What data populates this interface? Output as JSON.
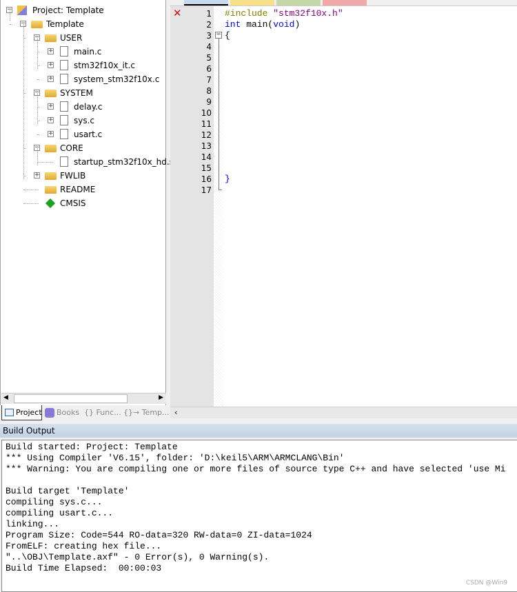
{
  "project_tree": [
    {
      "label": "Project: Template",
      "level": 0,
      "type": "project",
      "toggle": "-"
    },
    {
      "label": "Template",
      "level": 1,
      "type": "target",
      "toggle": "-"
    },
    {
      "label": "USER",
      "level": 2,
      "type": "folder",
      "toggle": "-"
    },
    {
      "label": "main.c",
      "level": 3,
      "type": "file",
      "toggle": "+"
    },
    {
      "label": "stm32f10x_it.c",
      "level": 3,
      "type": "file",
      "toggle": "+"
    },
    {
      "label": "system_stm32f10x.c",
      "level": 3,
      "type": "file",
      "toggle": "+"
    },
    {
      "label": "SYSTEM",
      "level": 2,
      "type": "folder",
      "toggle": "-"
    },
    {
      "label": "delay.c",
      "level": 3,
      "type": "file",
      "toggle": "+"
    },
    {
      "label": "sys.c",
      "level": 3,
      "type": "file",
      "toggle": "+"
    },
    {
      "label": "usart.c",
      "level": 3,
      "type": "file",
      "toggle": "+"
    },
    {
      "label": "CORE",
      "level": 2,
      "type": "folder",
      "toggle": "-"
    },
    {
      "label": "startup_stm32f10x_hd.s",
      "level": 3,
      "type": "file",
      "toggle": ""
    },
    {
      "label": "FWLIB",
      "level": 2,
      "type": "folder",
      "toggle": "+"
    },
    {
      "label": "README",
      "level": 2,
      "type": "folder",
      "toggle": ""
    },
    {
      "label": "CMSIS",
      "level": 2,
      "type": "cmsis",
      "toggle": ""
    }
  ],
  "panel_tabs": [
    {
      "label": "Project",
      "active": true
    },
    {
      "label": "Books"
    },
    {
      "label": "{} Func..."
    },
    {
      "label": "{}→ Temp..."
    }
  ],
  "editor": {
    "tab_colors": [
      "#c8d8f0",
      "#f8e08a",
      "#c4d8a8",
      "#f0a8a8"
    ],
    "error_icon": "x-error-icon",
    "lines": [
      [
        {
          "t": "#include ",
          "c": "#808000"
        },
        {
          "t": "\"stm32f10x.h\"",
          "c": "#800080"
        }
      ],
      [
        {
          "t": "int",
          "c": "#0000ff"
        },
        {
          "t": " main(",
          "c": "#000"
        },
        {
          "t": "void",
          "c": "#0000ff"
        },
        {
          "t": ")",
          "c": "#000"
        }
      ],
      [
        {
          "t": "{",
          "c": "#000"
        }
      ],
      [],
      [],
      [],
      [],
      [],
      [],
      [],
      [],
      [],
      [],
      [],
      [],
      [
        {
          "t": "}",
          "c": "#0000ff"
        }
      ],
      []
    ]
  },
  "build_output": {
    "title": "Build Output",
    "lines": [
      "Build started: Project: Template",
      "*** Using Compiler 'V6.15', folder: 'D:\\keil5\\ARM\\ARMCLANG\\Bin'",
      "*** Warning: You are compiling one or more files of source type C++ and have selected 'use Mi",
      "",
      "Build target 'Template'",
      "compiling sys.c...",
      "compiling usart.c...",
      "linking...",
      "Program Size: Code=544 RO-data=320 RW-data=0 ZI-data=1024",
      "FromELF: creating hex file...",
      "\"..\\OBJ\\Template.axf\" - 0 Error(s), 0 Warning(s).",
      "Build Time Elapsed:  00:00:03"
    ]
  },
  "watermark": "CSDN @Win9"
}
